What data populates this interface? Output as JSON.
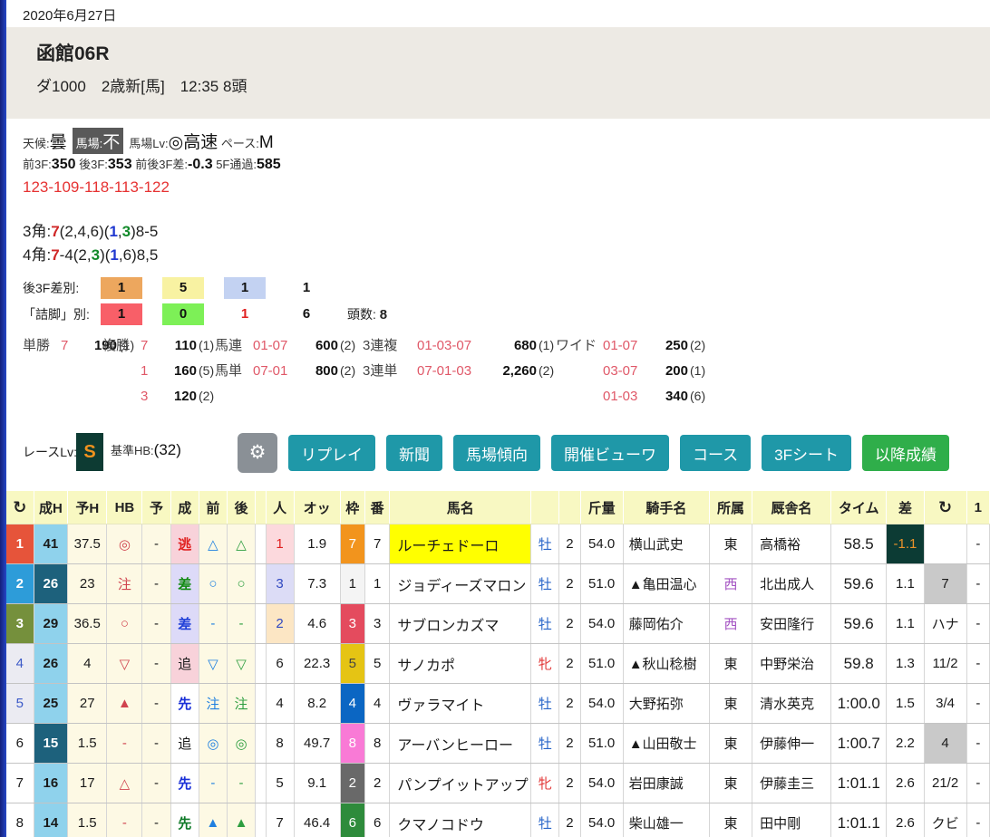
{
  "page": {
    "date": "2020年6月27日"
  },
  "race_header": {
    "title": "函館06R",
    "subtitle": "ダ1000　2歳新[馬]　12:35 8頭"
  },
  "conditions": {
    "left_segments": [
      {
        "t": "天候:",
        "c": "lbl"
      },
      {
        "t": "曇",
        "c": "big"
      }
    ],
    "badge_segments": [
      {
        "t": "馬場:",
        "c": "lblw"
      },
      {
        "t": "不",
        "c": "bigw"
      }
    ],
    "right_segments": [
      {
        "t": "馬場Lv:",
        "c": "lbl"
      },
      {
        "t": "◎高速",
        "c": "big"
      },
      {
        "t": " ",
        "c": "lbl"
      },
      {
        "t": "ペース:",
        "c": "lbl"
      },
      {
        "t": "M",
        "c": "big"
      }
    ]
  },
  "pace_stats": {
    "segments": [
      {
        "t": "前3F:",
        "c": "lbl"
      },
      {
        "t": "350",
        "c": "val"
      },
      {
        "t": " 後3F:",
        "c": "lbl"
      },
      {
        "t": "353",
        "c": "val"
      },
      {
        "t": " 前後3F差:",
        "c": "lbl"
      },
      {
        "t": "-0.3",
        "c": "val"
      },
      {
        "t": " 5F通過:",
        "c": "lbl"
      },
      {
        "t": "585",
        "c": "val"
      }
    ]
  },
  "lap_times": "123-109-118-113-122",
  "corner3": {
    "segments": [
      {
        "t": "3角:"
      },
      {
        "t": "7",
        "c": "red"
      },
      {
        "t": "(2,4,6)("
      },
      {
        "t": "1",
        "c": "blue"
      },
      {
        "t": ","
      },
      {
        "t": "3",
        "c": "green"
      },
      {
        "t": ")8-5"
      }
    ]
  },
  "corner4": {
    "segments": [
      {
        "t": "4角:"
      },
      {
        "t": "7",
        "c": "red"
      },
      {
        "t": "-4(2,"
      },
      {
        "t": "3",
        "c": "green"
      },
      {
        "t": ")("
      },
      {
        "t": "1",
        "c": "blue"
      },
      {
        "t": ",6)8,5"
      }
    ]
  },
  "rear3f": {
    "label": "後3F差別:",
    "cells": [
      {
        "t": "1",
        "bg": "#eda75e"
      },
      {
        "t": "5",
        "bg": "#f8f2a2"
      },
      {
        "t": "1",
        "bg": "#c3d2f2"
      },
      {
        "t": "1"
      }
    ]
  },
  "tsume": {
    "label": "「詰脚」別:",
    "cells": [
      {
        "t": "1",
        "bg": "#f85f68"
      },
      {
        "t": "0",
        "bg": "#7df057"
      },
      {
        "t": "1",
        "fg": "#e02020"
      },
      {
        "t": "6"
      }
    ],
    "suffix_label": "頭数:",
    "suffix_value": "8"
  },
  "payouts": {
    "columns": [
      {
        "rows": [
          {
            "label": "単勝",
            "nums": "7",
            "amt": "190",
            "pop": "(1)"
          }
        ]
      },
      {
        "rows": [
          {
            "label": "複勝",
            "nums": "7",
            "amt": "110",
            "pop": "(1)"
          },
          {
            "label": "",
            "nums": "1",
            "amt": "160",
            "pop": "(5)"
          },
          {
            "label": "",
            "nums": "3",
            "amt": "120",
            "pop": "(2)"
          }
        ]
      },
      {
        "rows": [
          {
            "label": "馬連",
            "nums": "01-07",
            "amt": "600",
            "pop": "(2)"
          },
          {
            "label": "馬単",
            "nums": "07-01",
            "amt": "800",
            "pop": "(2)"
          }
        ]
      },
      {
        "rows": [
          {
            "label": "3連複",
            "nums": "01-03-07",
            "amt": "680",
            "pop": "(1)"
          },
          {
            "label": "3連単",
            "nums": "07-01-03",
            "amt": "2,260",
            "pop": "(2)"
          }
        ]
      },
      {
        "rows": [
          {
            "label": "ワイド",
            "nums": "01-07",
            "amt": "250",
            "pop": "(2)"
          },
          {
            "label": "",
            "nums": "03-07",
            "amt": "200",
            "pop": "(1)"
          },
          {
            "label": "",
            "nums": "01-03",
            "amt": "340",
            "pop": "(6)"
          }
        ]
      }
    ]
  },
  "race_level": {
    "label": "レースLv:",
    "value": "S",
    "hb_segments": [
      {
        "t": "基準HB:",
        "c": "lbl"
      },
      {
        "t": "(32)",
        "c": "big2"
      }
    ]
  },
  "toolbar": {
    "gear_icon": "⚙",
    "buttons": [
      {
        "name": "replay-button",
        "label": "リプレイ",
        "color": "#1f98a8"
      },
      {
        "name": "newspaper-button",
        "label": "新聞",
        "color": "#1f98a8"
      },
      {
        "name": "track-trend-button",
        "label": "馬場傾向",
        "color": "#1f98a8"
      },
      {
        "name": "meeting-viewer-button",
        "label": "開催ビューワ",
        "color": "#1f98a8"
      },
      {
        "name": "course-button",
        "label": "コース",
        "color": "#1f98a8"
      },
      {
        "name": "3f-sheet-button",
        "label": "3Fシート",
        "color": "#1f98a8"
      },
      {
        "name": "later-results-button",
        "label": "以降成績",
        "color": "#2fae4a"
      }
    ]
  },
  "results_table": {
    "headers": {
      "place": "↻",
      "seiH": "成H",
      "yoH": "予H",
      "hb": "HB",
      "yo": "予",
      "sei": "成",
      "mae": "前",
      "ato": "後",
      "gap": "",
      "nin": "人",
      "odds": "オッ",
      "waku": "枠",
      "ban": "番",
      "name": "馬名",
      "sex": "",
      "age": "",
      "wt": "斤量",
      "jockey": "騎手名",
      "aff": "所属",
      "stable": "厩舎名",
      "time": "タイム",
      "sa": "差",
      "margin": "↻",
      "extra": "1"
    },
    "rows": [
      {
        "place": {
          "t": "1",
          "bg": "#e6543a",
          "fg": "#ffffff",
          "b": 1
        },
        "seiH": {
          "t": "41",
          "bg": "#8fd2ec",
          "b": 1
        },
        "yoH": "37.5",
        "hb": "◎",
        "yo": "-",
        "sei": {
          "t": "逃",
          "bg": "#f8d2da",
          "fg": "#e02020",
          "b": 1
        },
        "mae": "△",
        "ato": "△",
        "gap": "",
        "nin": {
          "t": "1",
          "bg": "#fcd9dd",
          "fg": "#e02020"
        },
        "odds": "1.9",
        "waku": {
          "t": "7",
          "bg": "#f2941d",
          "fg": "#ffffff"
        },
        "ban": "7",
        "name": {
          "t": "ルーチェドーロ",
          "bg": "#ffff00"
        },
        "sex": {
          "t": "牡",
          "fg": "#2664c8"
        },
        "age": "2",
        "wt": "54.0",
        "jockey": "横山武史",
        "aff": "東",
        "stable": "高橋裕",
        "time": "58.5",
        "sa": {
          "t": "-1.1",
          "bg": "#0c3b34",
          "fg": "#e8922a"
        },
        "margin": "",
        "extra": "-"
      },
      {
        "place": {
          "t": "2",
          "bg": "#2d9cd9",
          "fg": "#ffffff",
          "b": 1
        },
        "seiH": {
          "t": "26",
          "bg": "#1d617c",
          "fg": "#ffffff",
          "b": 1
        },
        "yoH": "23",
        "hb": "注",
        "yo": "-",
        "sei": {
          "t": "差",
          "bg": "#dddaf8",
          "fg": "#128a12",
          "b": 1
        },
        "mae": "○",
        "ato": "○",
        "gap": "",
        "nin": {
          "t": "3",
          "bg": "#dcdcf6",
          "fg": "#3048c0"
        },
        "odds": "7.3",
        "waku": {
          "t": "1",
          "bg": "#f4f4f4"
        },
        "ban": "1",
        "name": "ジョディーズマロン",
        "sex": {
          "t": "牡",
          "fg": "#2664c8"
        },
        "age": "2",
        "wt": "51.0",
        "jockey": "▲亀田温心",
        "aff": {
          "t": "西",
          "fg": "#a352c2"
        },
        "stable": "北出成人",
        "time": "59.6",
        "sa": "1.1",
        "margin": {
          "t": "7",
          "bg": "#c9c9c9"
        },
        "extra": "-"
      },
      {
        "place": {
          "t": "3",
          "bg": "#75903c",
          "fg": "#ffffff",
          "b": 1
        },
        "seiH": {
          "t": "29",
          "bg": "#8fd2ec",
          "b": 1
        },
        "yoH": "36.5",
        "hb": "○",
        "yo": "-",
        "sei": {
          "t": "差",
          "bg": "#dddaf8",
          "fg": "#2040d8",
          "b": 1
        },
        "mae": "-",
        "ato": "-",
        "gap": "",
        "nin": {
          "t": "2",
          "bg": "#fce6c4",
          "fg": "#3048c0"
        },
        "odds": "4.6",
        "waku": {
          "t": "3",
          "bg": "#e44b5e",
          "fg": "#ffffff"
        },
        "ban": "3",
        "name": "サブロンカズマ",
        "sex": {
          "t": "牡",
          "fg": "#2664c8"
        },
        "age": "2",
        "wt": "54.0",
        "jockey": "藤岡佑介",
        "aff": {
          "t": "西",
          "fg": "#a352c2"
        },
        "stable": "安田隆行",
        "time": "59.6",
        "sa": "1.1",
        "margin": "ハナ",
        "extra": "-"
      },
      {
        "place": {
          "t": "4",
          "bg": "#ebebf2",
          "fg": "#3c5ac8"
        },
        "seiH": {
          "t": "26",
          "bg": "#8fd2ec",
          "b": 1
        },
        "yoH": "4",
        "hb": "▽",
        "yo": "-",
        "sei": {
          "t": "追",
          "bg": "#f8d2da"
        },
        "mae": "▽",
        "ato": "▽",
        "gap": "",
        "nin": "6",
        "odds": "22.3",
        "waku": {
          "t": "5",
          "bg": "#e5c414",
          "fg": "#444444"
        },
        "ban": "5",
        "name": "サノカポ",
        "sex": {
          "t": "牝",
          "fg": "#e23636"
        },
        "age": "2",
        "wt": "51.0",
        "jockey": "▲秋山稔樹",
        "aff": "東",
        "stable": "中野栄治",
        "time": "59.8",
        "sa": "1.3",
        "margin": "11/2",
        "extra": "-"
      },
      {
        "place": {
          "t": "5",
          "bg": "#ebebf2",
          "fg": "#3c5ac8"
        },
        "seiH": {
          "t": "25",
          "bg": "#8fd2ec",
          "b": 1
        },
        "yoH": "27",
        "hb": "▲",
        "yo": "-",
        "sei": {
          "t": "先",
          "fg": "#1a30d8",
          "b": 1
        },
        "mae": "注",
        "ato": "注",
        "gap": "",
        "nin": "4",
        "odds": "8.2",
        "waku": {
          "t": "4",
          "bg": "#0b66c3",
          "fg": "#ffffff"
        },
        "ban": "4",
        "name": "ヴァラマイト",
        "sex": {
          "t": "牡",
          "fg": "#2664c8"
        },
        "age": "2",
        "wt": "54.0",
        "jockey": "大野拓弥",
        "aff": "東",
        "stable": "清水英克",
        "time": "1:00.0",
        "sa": "1.5",
        "margin": "3/4",
        "extra": "-"
      },
      {
        "place": "6",
        "seiH": {
          "t": "15",
          "bg": "#1d617c",
          "fg": "#ffffff",
          "b": 1
        },
        "yoH": "1.5",
        "hb": "-",
        "yo": "-",
        "sei": "追",
        "mae": "◎",
        "ato": "◎",
        "gap": "",
        "nin": "8",
        "odds": "49.7",
        "waku": {
          "t": "8",
          "bg": "#f97ad6",
          "fg": "#ffffff"
        },
        "ban": "8",
        "name": "アーバンヒーロー",
        "sex": {
          "t": "牡",
          "fg": "#2664c8"
        },
        "age": "2",
        "wt": "51.0",
        "jockey": "▲山田敬士",
        "aff": "東",
        "stable": "伊藤伸一",
        "time": "1:00.7",
        "sa": "2.2",
        "margin": {
          "t": "4",
          "bg": "#c9c9c9"
        },
        "extra": "-"
      },
      {
        "place": "7",
        "seiH": {
          "t": "16",
          "bg": "#8fd2ec",
          "b": 1
        },
        "yoH": "17",
        "hb": "△",
        "yo": "-",
        "sei": {
          "t": "先",
          "fg": "#1a30d8",
          "b": 1
        },
        "mae": "-",
        "ato": "-",
        "gap": "",
        "nin": "5",
        "odds": "9.1",
        "waku": {
          "t": "2",
          "bg": "#696969",
          "fg": "#ffffff"
        },
        "ban": "2",
        "name": "パンプイットアップ",
        "sex": {
          "t": "牝",
          "fg": "#e23636"
        },
        "age": "2",
        "wt": "54.0",
        "jockey": "岩田康誠",
        "aff": "東",
        "stable": "伊藤圭三",
        "time": "1:01.1",
        "sa": "2.6",
        "margin": "21/2",
        "extra": "-"
      },
      {
        "place": "8",
        "seiH": {
          "t": "14",
          "bg": "#8fd2ec",
          "b": 1
        },
        "yoH": "1.5",
        "hb": "-",
        "yo": "-",
        "sei": {
          "t": "先",
          "fg": "#0f7a28",
          "b": 1
        },
        "mae": "▲",
        "ato": "▲",
        "gap": "",
        "nin": "7",
        "odds": "46.4",
        "waku": {
          "t": "6",
          "bg": "#2e8b3b",
          "fg": "#ffffff"
        },
        "ban": "6",
        "name": "クマノコドウ",
        "sex": {
          "t": "牡",
          "fg": "#2664c8"
        },
        "age": "2",
        "wt": "54.0",
        "jockey": "柴山雄一",
        "aff": "東",
        "stable": "田中剛",
        "time": "1:01.1",
        "sa": "2.6",
        "margin": "クビ",
        "extra": "-"
      }
    ]
  }
}
